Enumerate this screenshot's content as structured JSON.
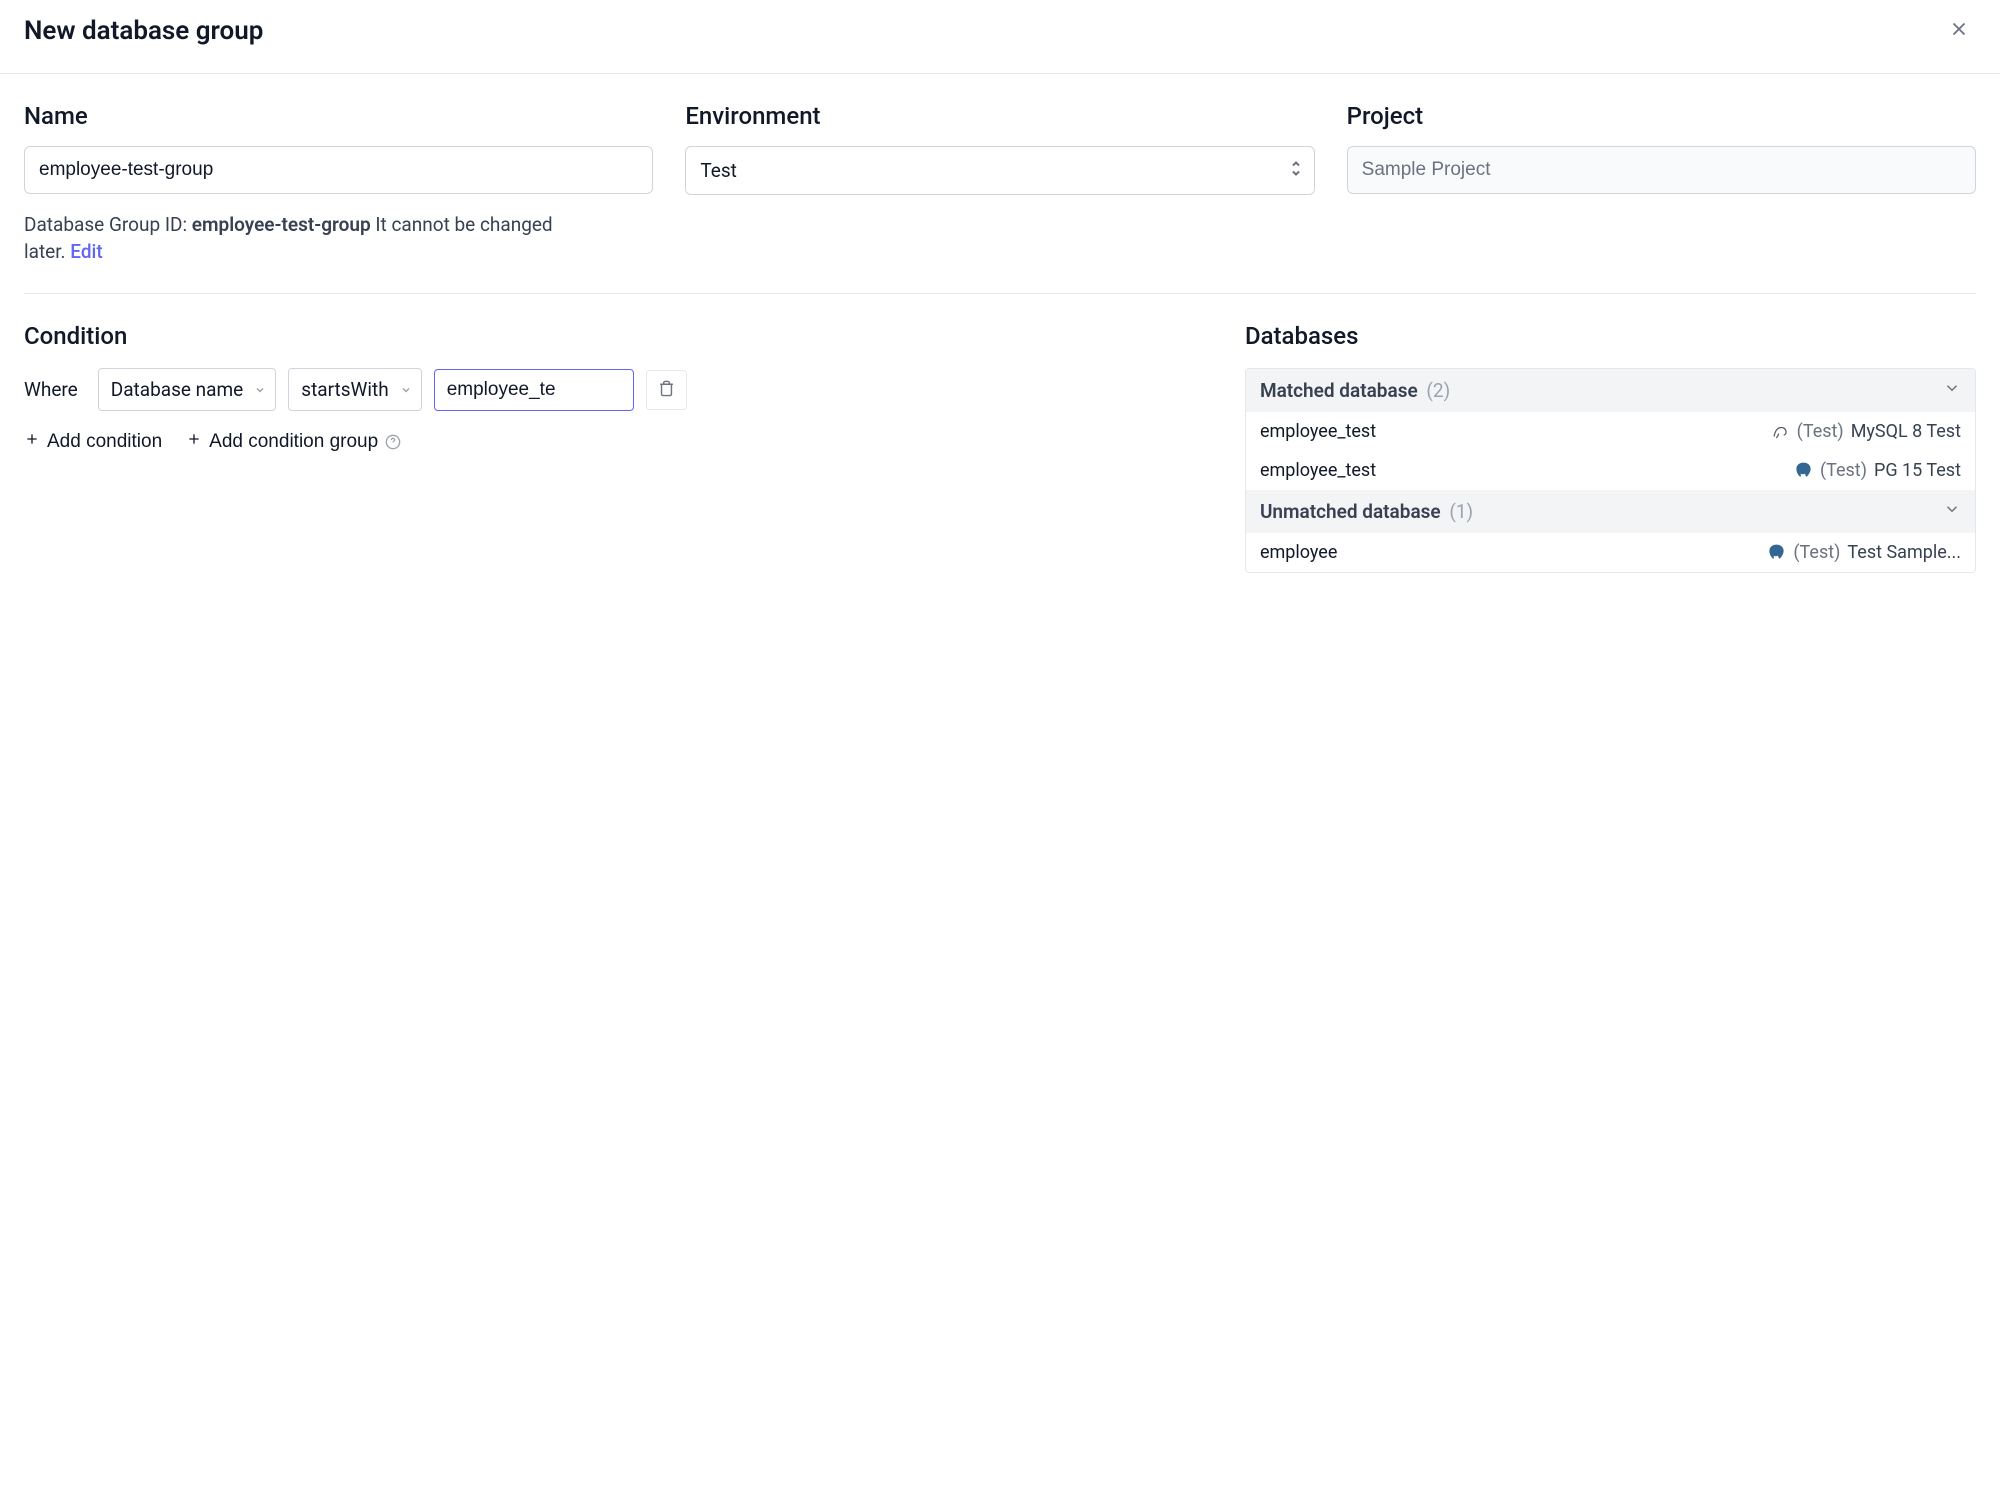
{
  "header": {
    "title": "New database group"
  },
  "fields": {
    "name": {
      "label": "Name",
      "value": "employee-test-group"
    },
    "environment": {
      "label": "Environment",
      "value": "Test"
    },
    "project": {
      "label": "Project",
      "value": "Sample Project"
    },
    "helper": {
      "prefix": "Database Group ID: ",
      "id": "employee-test-group",
      "suffix": " It cannot be changed later. ",
      "edit": "Edit"
    }
  },
  "condition": {
    "title": "Condition",
    "where": "Where",
    "field": "Database name",
    "operator": "startsWith",
    "value": "employee_te",
    "add_condition": "Add condition",
    "add_group": "Add condition group"
  },
  "databases": {
    "title": "Databases",
    "matched": {
      "label": "Matched database",
      "count": "(2)",
      "items": [
        {
          "name": "employee_test",
          "env": "(Test)",
          "label": "MySQL 8 Test",
          "icon": "mysql"
        },
        {
          "name": "employee_test",
          "env": "(Test)",
          "label": "PG 15 Test",
          "icon": "pg"
        }
      ]
    },
    "unmatched": {
      "label": "Unmatched database",
      "count": "(1)",
      "items": [
        {
          "name": "employee",
          "env": "(Test)",
          "label": "Test Sample...",
          "icon": "pg"
        }
      ]
    }
  }
}
